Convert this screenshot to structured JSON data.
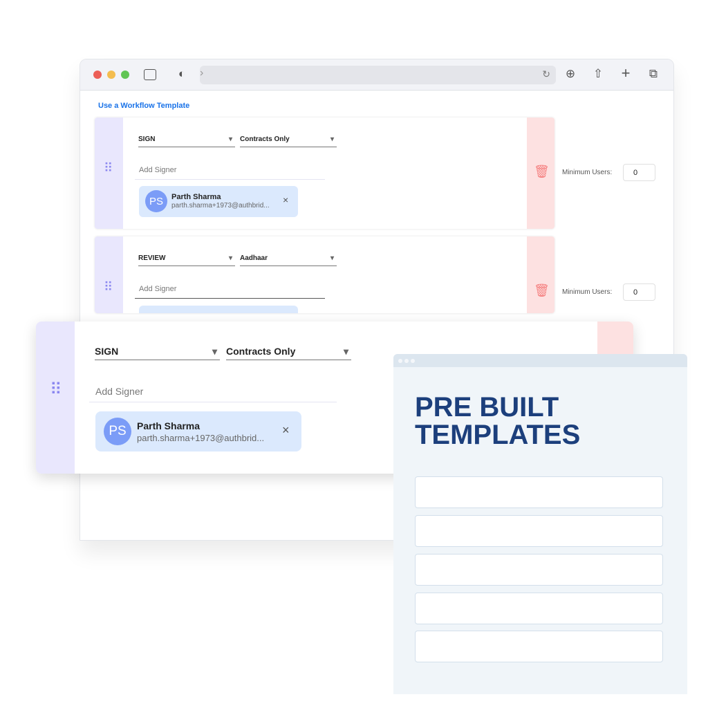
{
  "browser": {
    "toolbar_icons": [
      "sidebar-icon",
      "shield-icon",
      "chevron-right-icon",
      "reload-icon",
      "download-icon",
      "share-icon",
      "plus-icon",
      "tabs-icon"
    ],
    "traffic_lights": [
      "#ec5f57",
      "#f4bd4f",
      "#61c554"
    ]
  },
  "page": {
    "template_link": "Use a Workflow Template",
    "steps": [
      {
        "action": "SIGN",
        "type": "Contracts Only",
        "add_signer_placeholder": "Add Signer",
        "signer": {
          "initials": "PS",
          "name": "Parth Sharma",
          "email": "parth.sharma+1973@authbrid..."
        },
        "min_users_label": "Minimum Users:",
        "min_users": "0"
      },
      {
        "action": "REVIEW",
        "type": "Aadhaar",
        "add_signer_placeholder": "Add Signer",
        "min_users_label": "Minimum Users:",
        "min_users": "0"
      }
    ]
  },
  "floating_step": {
    "action": "SIGN",
    "type": "Contracts Only",
    "add_signer_placeholder": "Add Signer",
    "signer": {
      "initials": "PS",
      "name": "Parth Sharma",
      "email": "parth.sharma+1973@authbrid..."
    }
  },
  "templates_panel": {
    "title_line1": "PRE BUILT",
    "title_line2": "TEMPLATES",
    "rows": 5
  },
  "icons": {
    "caret": "▾",
    "close": "×",
    "drag": "⠿",
    "trash": "🗑"
  },
  "colors": {
    "accent": "#1a73e8",
    "title": "#1c3f7c",
    "drag_strip": "#e9e7fd",
    "delete_strip": "#fde1e1",
    "chip": "#dbe9fd",
    "avatar": "#7b9cf7"
  }
}
